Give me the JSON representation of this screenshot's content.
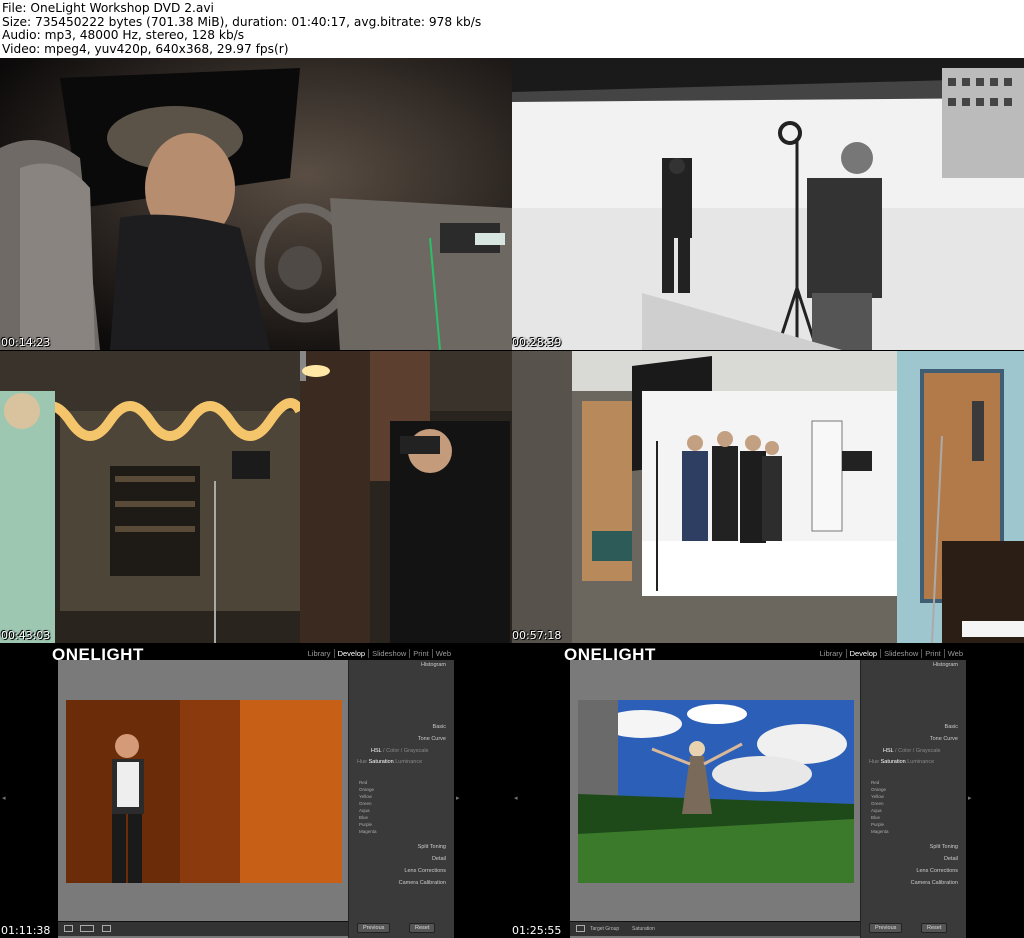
{
  "header": {
    "file": "File: OneLight Workshop DVD 2.avi",
    "size": "Size: 735450222 bytes (701.38 MiB), duration: 01:40:17, avg.bitrate: 978 kb/s",
    "audio": "Audio: mp3, 48000 Hz, stereo, 128 kb/s",
    "video": "Video: mpeg4, yuv420p, 640x368, 29.97 fps(r)"
  },
  "thumbnails": [
    {
      "timestamp": "00:14:23"
    },
    {
      "timestamp": "00:28:39"
    },
    {
      "timestamp": "00:43:03"
    },
    {
      "timestamp": "00:57:18"
    },
    {
      "timestamp": "01:11:38"
    },
    {
      "timestamp": "01:25:55"
    }
  ],
  "lightroom": {
    "logo": "ONELIGHT",
    "nav": [
      "Library",
      "Develop",
      "Slideshow",
      "Print",
      "Web"
    ],
    "active_nav": "Develop",
    "panels": {
      "histogram": "Histogram",
      "basic": "Basic",
      "tone_curve": "Tone Curve",
      "hsl_tabs": [
        "HSL",
        "Color",
        "Grayscale"
      ],
      "sub_tabs": [
        "Hue",
        "Saturation",
        "Luminance",
        "All"
      ],
      "color_rows": [
        "Red",
        "Orange",
        "Yellow",
        "Green",
        "Aqua",
        "Blue",
        "Purple",
        "Magenta"
      ],
      "split_toning": "Split Toning",
      "detail": "Detail",
      "lens_corrections": "Lens Corrections",
      "camera_calibration": "Camera Calibration"
    },
    "buttons": {
      "previous": "Previous",
      "reset": "Reset"
    },
    "toolbar": {
      "target_group": "Target Group",
      "saturation": "Saturation"
    }
  }
}
